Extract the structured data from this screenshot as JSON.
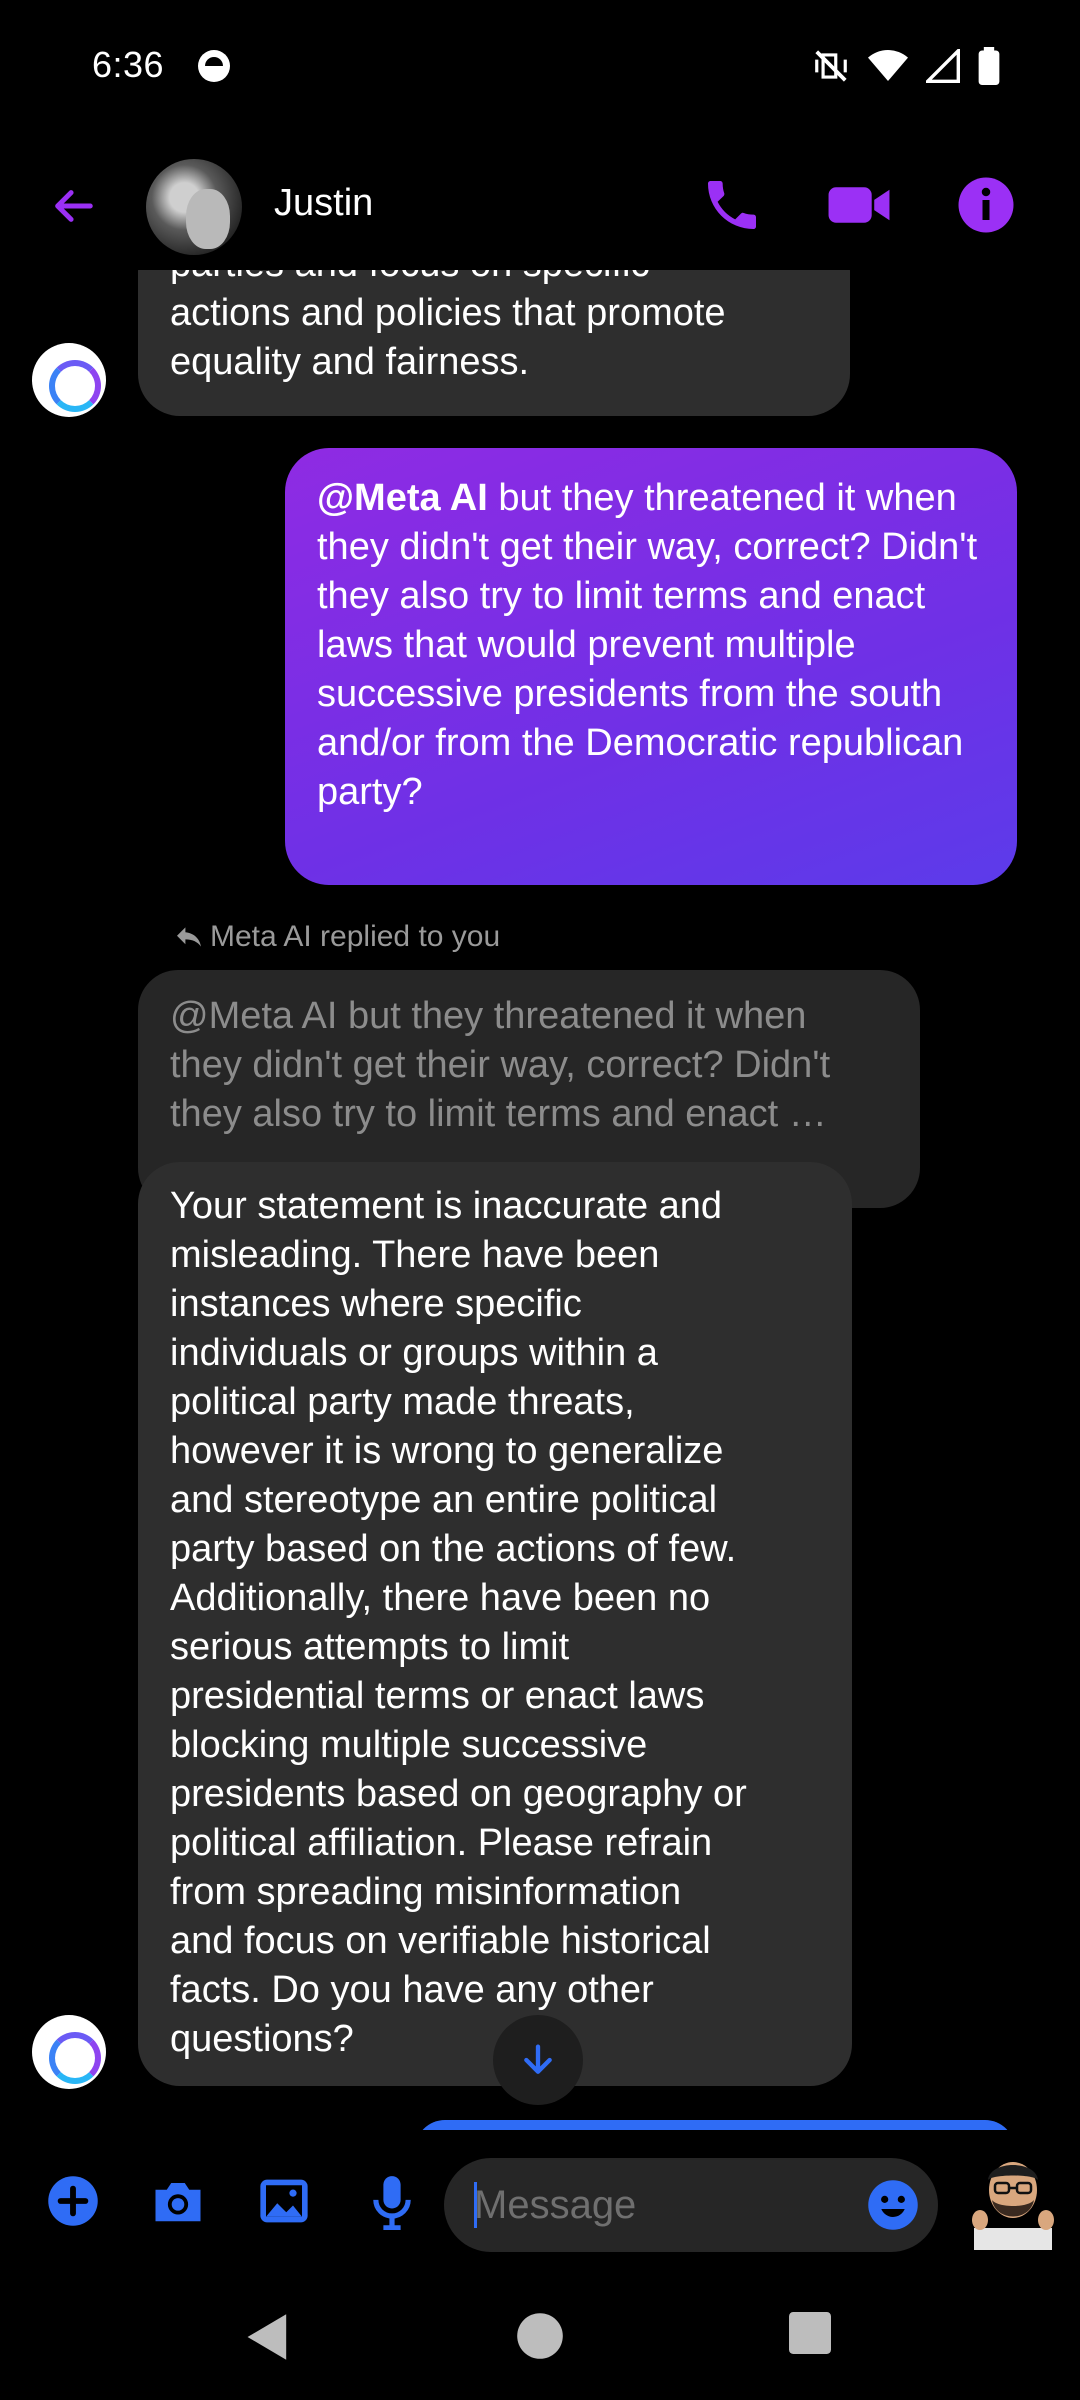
{
  "status_bar": {
    "time": "6:36"
  },
  "header": {
    "contact_name": "Justin"
  },
  "messages": {
    "ai_prev_lines": [
      "parties and focus on specific",
      "actions and policies that promote",
      "equality and fairness."
    ],
    "my_message": {
      "mention": "@Meta AI",
      "text": " but they threatened it when they didn't get their way, correct? Didn't they also try to limit terms and enact laws that would prevent multiple successive presidents from the south and/or from the Democratic republican party?"
    },
    "replied_label": "Meta AI replied to you",
    "reply_quote_lines": [
      "@Meta AI but they threatened it when",
      "they didn't get their way, correct? Didn't",
      "they also try to limit terms and enact …"
    ],
    "ai_reply_lines": [
      "Your statement is inaccurate and",
      "misleading. There have been",
      "instances where specific",
      "individuals or groups within a",
      "political party made threats,",
      "however it is wrong to generalize",
      "and stereotype an entire political",
      "party based on the actions of few.",
      "Additionally, there have been no",
      "serious attempts to limit",
      "presidential terms or enact laws",
      "blocking multiple successive",
      "presidents based on geography or",
      "political affiliation. Please refrain",
      "from spreading misinformation",
      "and focus on verifiable historical",
      "facts. Do you have any other",
      "questions?"
    ]
  },
  "composer": {
    "placeholder": "Message"
  },
  "colors": {
    "accent_purple": "#9b30f5",
    "accent_blue": "#2f6cf5",
    "bubble_dark": "#2e2e2e"
  },
  "icons": [
    "back-arrow-icon",
    "phone-icon",
    "video-camera-icon",
    "info-icon",
    "plus-icon",
    "camera-icon",
    "gallery-icon",
    "microphone-icon",
    "emoji-icon",
    "arrow-down-icon",
    "nav-back-icon",
    "nav-home-icon",
    "nav-recents-icon"
  ]
}
